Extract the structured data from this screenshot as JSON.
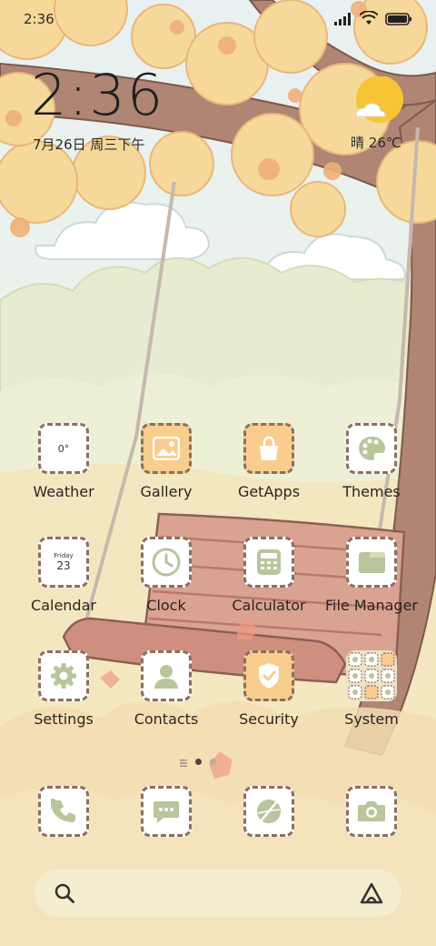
{
  "status_bar": {
    "time": "2:36",
    "icons": [
      "signal-icon",
      "wifi-icon",
      "battery-icon"
    ]
  },
  "clock_widget": {
    "time": "2:36",
    "date": "7月26日 周三下午"
  },
  "weather_widget": {
    "condition": "晴",
    "temperature": "26℃",
    "icon": "sun-cloud-icon"
  },
  "apps": [
    {
      "label": "Weather",
      "icon": "weather-icon",
      "tile_text": "0°"
    },
    {
      "label": "Gallery",
      "icon": "image-icon"
    },
    {
      "label": "GetApps",
      "icon": "shopping-bag-icon"
    },
    {
      "label": "Themes",
      "icon": "palette-icon"
    },
    {
      "label": "Calendar",
      "icon": "calendar-icon",
      "tile_day": "Friday",
      "tile_date": "23"
    },
    {
      "label": "Clock",
      "icon": "clock-icon"
    },
    {
      "label": "Calculator",
      "icon": "calculator-icon"
    },
    {
      "label": "File Manager",
      "icon": "folder-icon"
    },
    {
      "label": "Settings",
      "icon": "gear-icon"
    },
    {
      "label": "Contacts",
      "icon": "person-icon"
    },
    {
      "label": "Security",
      "icon": "shield-check-icon"
    },
    {
      "label": "System",
      "icon": "folder-grid-icon"
    }
  ],
  "dock": [
    {
      "icon": "phone-icon"
    },
    {
      "icon": "message-icon"
    },
    {
      "icon": "browser-icon"
    },
    {
      "icon": "camera-icon"
    }
  ],
  "pager": {
    "pages": 3,
    "current": 2
  },
  "search": {
    "icon": "search-icon",
    "assistant_icon": "assistant-icon"
  },
  "colors": {
    "tile_border": "#8a6f64",
    "tile_orange": "#f8cd8e",
    "icon_green": "#b9c59a",
    "sun": "#f7c533"
  }
}
